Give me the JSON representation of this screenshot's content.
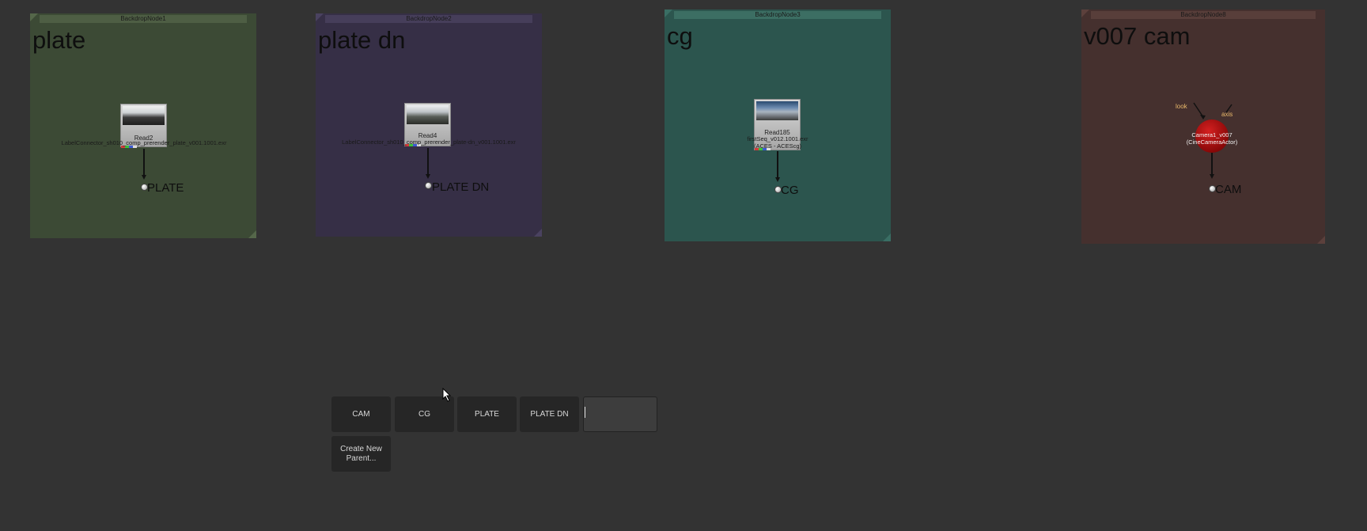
{
  "backdrops": [
    {
      "title": "BackdropNode1",
      "label": "plate",
      "color": "#3c4a35",
      "title_bg": "#4e5e44"
    },
    {
      "title": "BackdropNode2",
      "label": "plate dn",
      "color": "#362f46",
      "title_bg": "#463e5a"
    },
    {
      "title": "BackdropNode3",
      "label": "cg",
      "color": "#2c554e",
      "title_bg": "#3c6e63"
    },
    {
      "title": "BackdropNode8",
      "label": "v007 cam",
      "color": "#45302e",
      "title_bg": "#583e3a"
    }
  ],
  "nodes": {
    "read2": {
      "name": "Read2",
      "file": "LabelConnector_sh010_comp_prerender_plate_v001.1001.exr"
    },
    "read4": {
      "name": "Read4",
      "file": "LabelConnector_sh010_comp_prerender_plate-dn_v001.1001.exr"
    },
    "read185": {
      "name": "Read185",
      "file": "firstSeq_v012.1001.exr",
      "colorspace": "(ACES - ACEScg)"
    },
    "camera": {
      "name": "Camera1_v007",
      "type": "(CineCameraActor)",
      "input_look": "look",
      "input_axis": "axis",
      "color": "#9e0e0e"
    }
  },
  "dots": {
    "plate": "PLATE",
    "plate_dn": "PLATE DN",
    "cg": "CG",
    "cam": "CAM"
  },
  "parent_panel": {
    "buttons": [
      "CAM",
      "CG",
      "PLATE",
      "PLATE DN"
    ],
    "input_value": "",
    "create_button": "Create New\nParent..."
  }
}
